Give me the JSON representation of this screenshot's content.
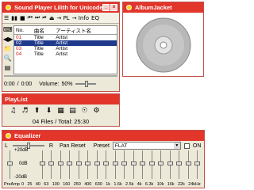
{
  "player": {
    "title": "Sound Player Lilith for Unicode OSs",
    "toolbar": [
      "☰",
      "▮▮",
      "■",
      "⏮",
      "⏭",
      "⏯",
      "⏏",
      "→ PL",
      "→ Info",
      "EQ"
    ],
    "toolbar_labels": [
      "file-menu",
      "pause",
      "stop",
      "previous",
      "next",
      "play",
      "eject",
      "pl",
      "info",
      "eq"
    ],
    "columns": [
      "No.",
      "曲名",
      "アーティスト名"
    ],
    "tracks": [
      {
        "no": "01",
        "title": "Title",
        "artist": "Artist",
        "selected": false
      },
      {
        "no": "02",
        "title": "Title",
        "artist": "Artist",
        "selected": true
      },
      {
        "no": "03",
        "title": "Title",
        "artist": "Artist",
        "selected": false
      },
      {
        "no": "04",
        "title": "Title",
        "artist": "Artist",
        "selected": false
      }
    ],
    "time_current": "0:00",
    "time_sep": "/",
    "time_total": "0:00",
    "volume_label": "Volume:",
    "volume_value": "50%",
    "volume_fraction": 0.5
  },
  "album": {
    "title": "AlbumJacket"
  },
  "playlist": {
    "title": "PlayList",
    "info": "04 Files / Total: 25:30"
  },
  "equalizer": {
    "title": "Equalizer",
    "balance_left": "L",
    "balance_right": "R",
    "pan_reset": "Pan Reset",
    "preset_label": "Preset",
    "preset_value": "FLAT",
    "on_label": "ON",
    "db_top": "+20dB",
    "db_mid": "0dB",
    "db_bottom": "-20dB",
    "preamp_label": "PreAmp",
    "frequencies": [
      "0",
      "25",
      "40",
      "63",
      "100",
      "160",
      "250",
      "400",
      "630",
      "1k",
      "1.6k",
      "2.5k",
      "4k",
      "6.3k",
      "10k",
      "16k",
      "22k",
      "24kHz"
    ]
  },
  "colors": {
    "titlebar": "#e2362b",
    "selection": "#1f3a8c",
    "track_no": "#d02018"
  }
}
